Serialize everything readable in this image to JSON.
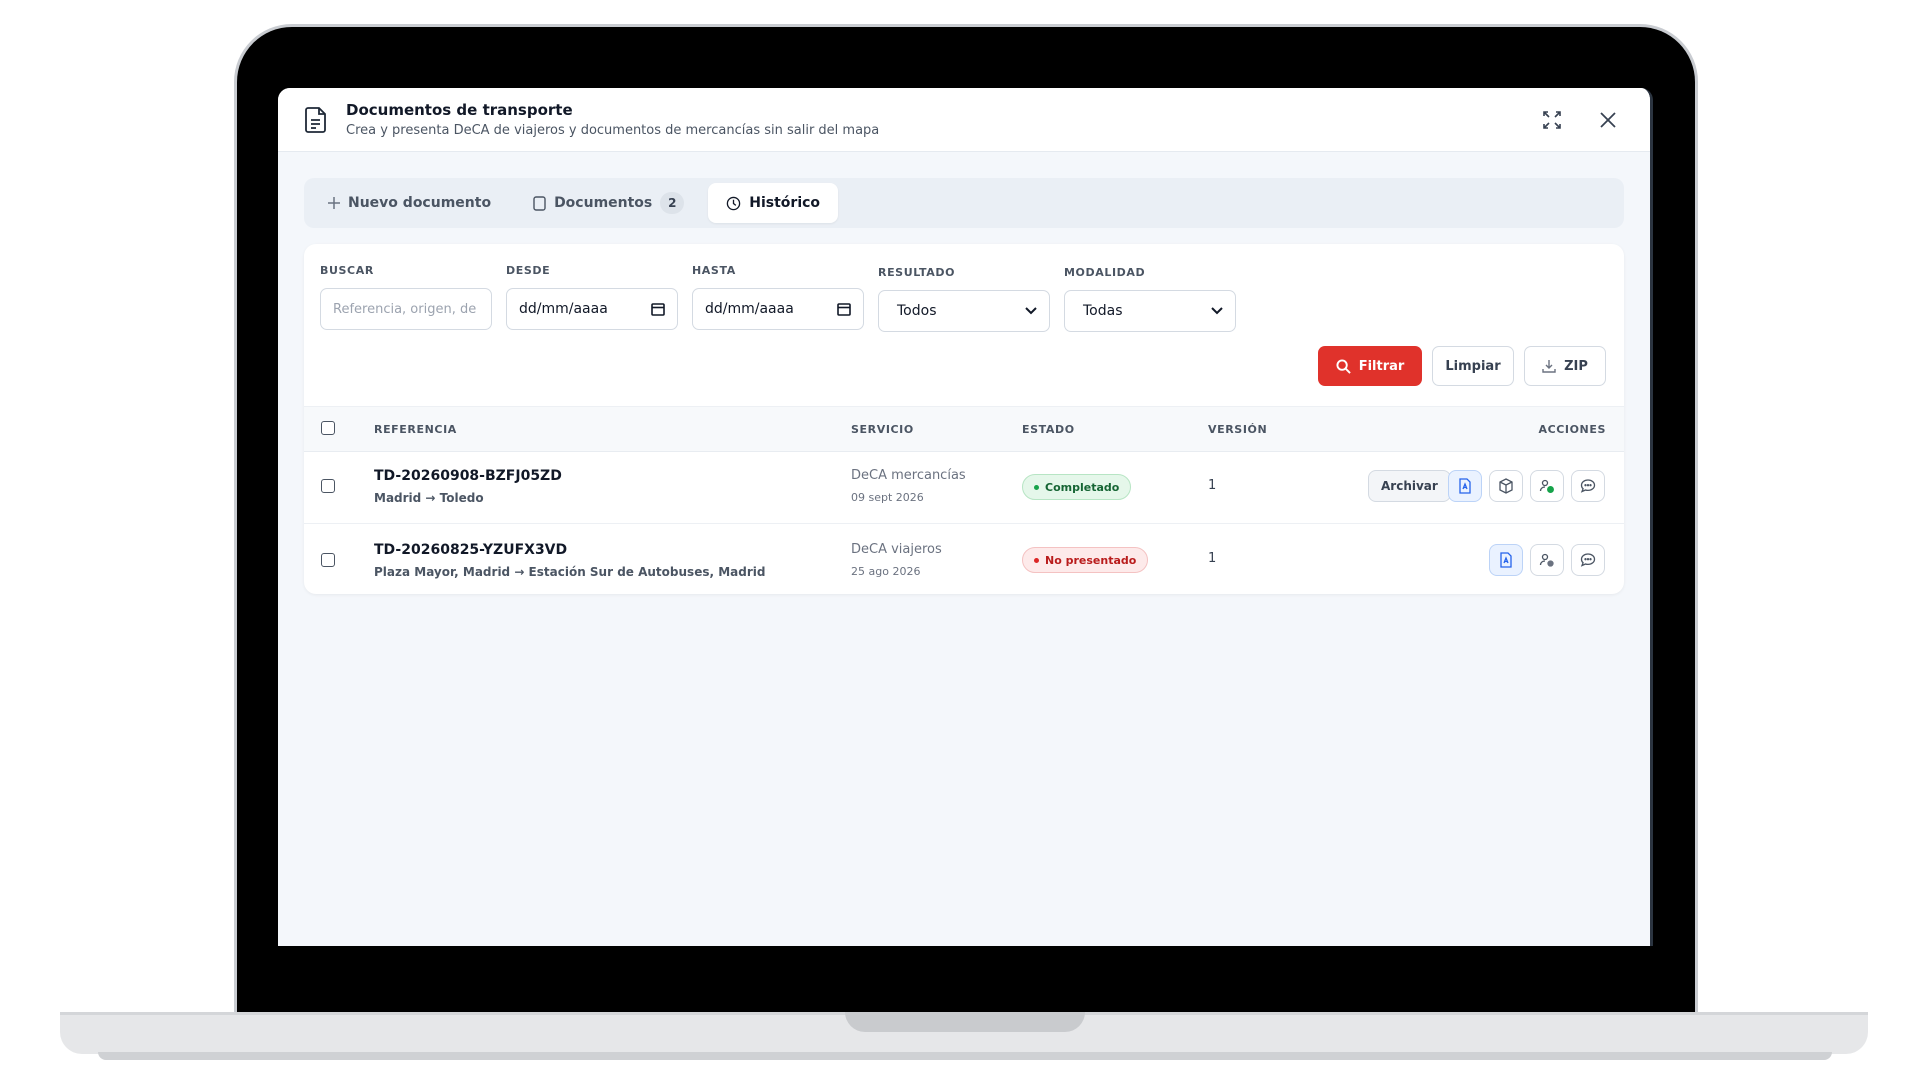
{
  "modal": {
    "title": "Documentos de transporte",
    "subtitle": "Crea y presenta DeCA de viajeros y documentos de mercancías sin salir del mapa"
  },
  "tabs": {
    "new_doc": "Nuevo documento",
    "documents": "Documentos",
    "documents_count": "2",
    "history": "Histórico",
    "active": "Histórico"
  },
  "filters": {
    "search_label": "BUSCAR",
    "search_placeholder": "Referencia, origen, de",
    "from_label": "DESDE",
    "from_value": "dd/mm/aaaa",
    "to_label": "HASTA",
    "to_value": "dd/mm/aaaa",
    "result_label": "RESULTADO",
    "result_value": "Todos",
    "modality_label": "MODALIDAD",
    "modality_value": "Todas",
    "filter_button": "Filtrar",
    "clear_button": "Limpiar",
    "zip_button": "ZIP"
  },
  "table": {
    "headers": {
      "reference": "REFERENCIA",
      "service": "SERVICIO",
      "status": "ESTADO",
      "version": "VERSIÓN",
      "actions": "ACCIONES"
    },
    "rows": [
      {
        "reference": "TD-20260908-BZFJ05ZD",
        "route": "Madrid → Toledo",
        "service": "DeCA mercancías",
        "date": "09 sept 2026",
        "status": "Completado",
        "version": "1",
        "archive": "Archivar"
      },
      {
        "reference": "TD-20260825-YZUFX3VD",
        "route": "Plaza Mayor, Madrid → Estación Sur de Autobuses, Madrid",
        "service": "DeCA viajeros",
        "date": "25 ago 2026",
        "status": "No presentado",
        "version": "1"
      }
    ]
  },
  "colors": {
    "accent_red": "#e0322b",
    "status_completed": "#16a34a",
    "status_not_submitted": "#dc2626"
  }
}
